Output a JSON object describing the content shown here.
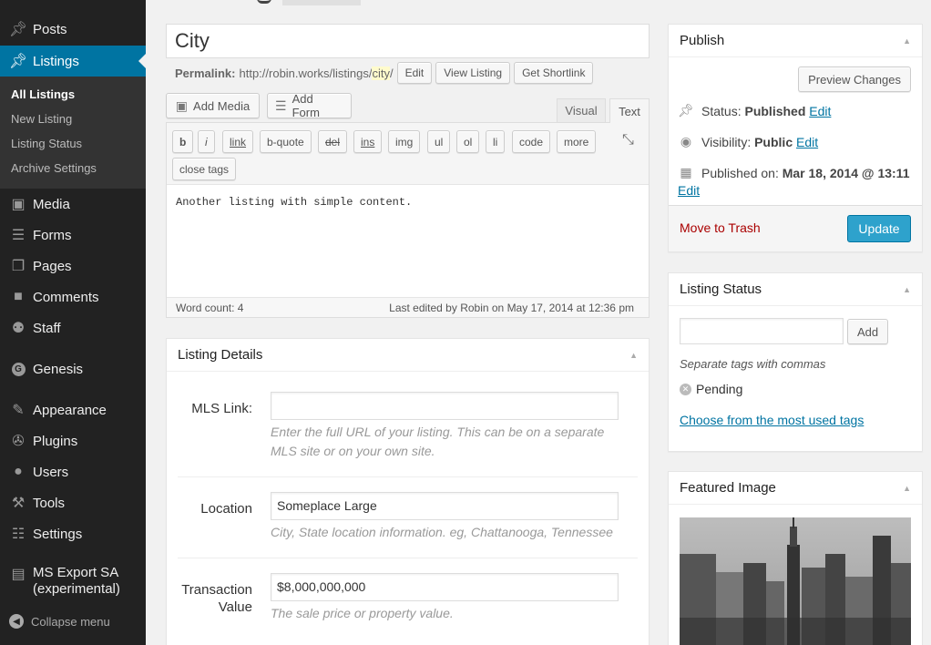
{
  "sidebar": {
    "items": [
      {
        "label": "Posts",
        "icon": "pin-icon"
      },
      {
        "label": "Listings",
        "icon": "pin-icon"
      },
      {
        "label": "Media",
        "icon": "media-icon"
      },
      {
        "label": "Forms",
        "icon": "forms-icon"
      },
      {
        "label": "Pages",
        "icon": "pages-icon"
      },
      {
        "label": "Comments",
        "icon": "comment-icon"
      },
      {
        "label": "Staff",
        "icon": "staff-icon"
      },
      {
        "label": "Genesis",
        "icon": "genesis-icon"
      },
      {
        "label": "Appearance",
        "icon": "brush-icon"
      },
      {
        "label": "Plugins",
        "icon": "plug-icon"
      },
      {
        "label": "Users",
        "icon": "user-icon"
      },
      {
        "label": "Tools",
        "icon": "wrench-icon"
      },
      {
        "label": "Settings",
        "icon": "settings-icon"
      },
      {
        "label": "MS Export SA",
        "label2": "(experimental)",
        "icon": "export-icon"
      }
    ],
    "submenu": [
      "All Listings",
      "New Listing",
      "Listing Status",
      "Archive Settings"
    ],
    "collapse": "Collapse menu"
  },
  "editor": {
    "title": "City",
    "permalink_label": "Permalink:",
    "permalink_base": "http://robin.works/listings/",
    "permalink_slug": "city",
    "permalink_end": "/",
    "edit_btn": "Edit",
    "view_btn": "View Listing",
    "shortlink_btn": "Get Shortlink",
    "add_media": "Add Media",
    "add_form": "Add Form",
    "tab_visual": "Visual",
    "tab_text": "Text",
    "quicktags": [
      "b",
      "i",
      "link",
      "b-quote",
      "del",
      "ins",
      "img",
      "ul",
      "ol",
      "li",
      "code",
      "more"
    ],
    "close_tags": "close tags",
    "content": "Another listing with simple content.",
    "word_count": "Word count: 4",
    "last_edited": "Last edited by Robin on May 17, 2014 at 12:36 pm"
  },
  "details": {
    "title": "Listing Details",
    "mls_label": "MLS Link:",
    "mls_value": "",
    "mls_desc1": "Enter the full URL of your listing. This can be on a separate",
    "mls_desc2": "MLS site or on your own site.",
    "location_label": "Location",
    "location_value": "Someplace Large",
    "location_desc": "City, State location information. eg, Chattanooga, Tennessee",
    "txn_label1": "Transaction",
    "txn_label2": "Value",
    "txn_value": "$8,000,000,000",
    "txn_desc": "The sale price or property value."
  },
  "publish": {
    "title": "Publish",
    "preview": "Preview Changes",
    "status_label": "Status:",
    "status_value": "Published",
    "visibility_label": "Visibility:",
    "visibility_value": "Public",
    "published_label": "Published on:",
    "published_value": "Mar 18, 2014 @ 13:11",
    "edit": "Edit",
    "trash": "Move to Trash",
    "update": "Update"
  },
  "listing_status": {
    "title": "Listing Status",
    "add": "Add",
    "hint": "Separate tags with commas",
    "tag": "Pending",
    "most_used": "Choose from the most used tags"
  },
  "featured": {
    "title": "Featured Image"
  }
}
